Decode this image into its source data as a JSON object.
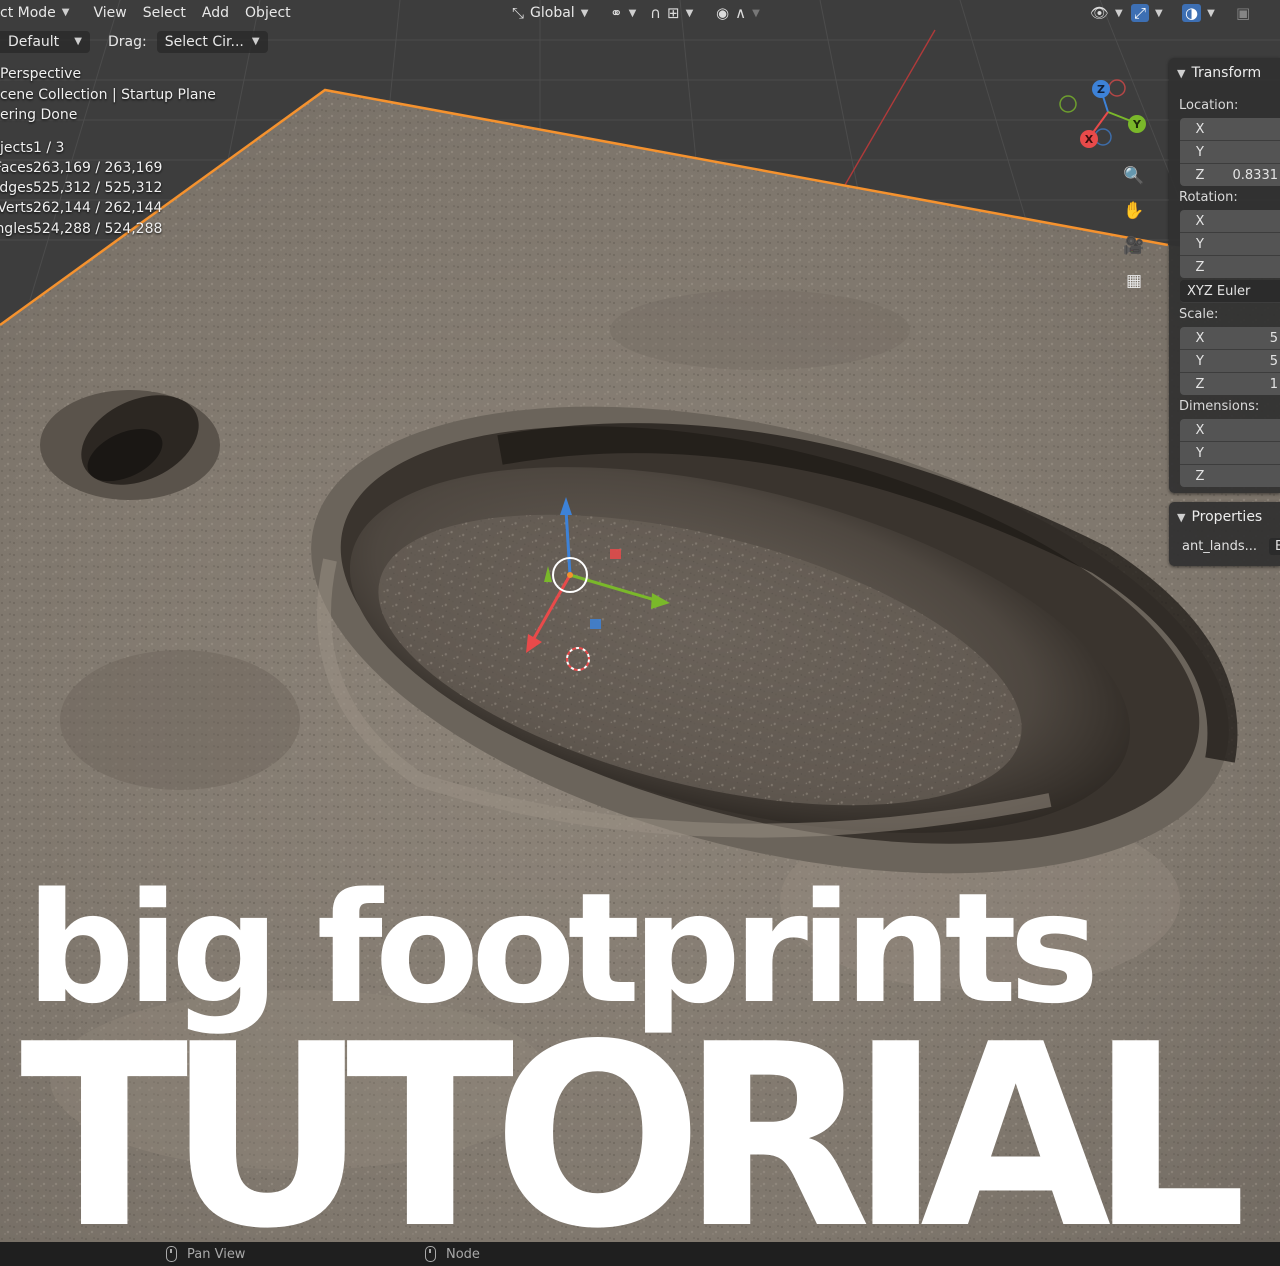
{
  "header": {
    "mode_label": "ct Mode",
    "menus": [
      "View",
      "Select",
      "Add",
      "Object"
    ],
    "transform_orientation": "Global",
    "orientation_preset": "Default",
    "drag_label": "Drag:",
    "drag_tool": "Select Cir..."
  },
  "overlay": {
    "view_name": "Perspective",
    "collection": "cene Collection | Startup Plane",
    "render_status": "ering Done",
    "stats": [
      {
        "key": "Objects",
        "value": "1 / 3"
      },
      {
        "key": "Faces",
        "value": "263,169 / 263,169"
      },
      {
        "key": "Edges",
        "value": "525,312 / 525,312"
      },
      {
        "key": "Verts",
        "value": "262,144 / 262,144"
      },
      {
        "key": "Triangles",
        "value": "524,288 / 524,288"
      }
    ]
  },
  "gizmo": {
    "x": "X",
    "y": "Y",
    "z": "Z",
    "x_color": "#e84a4a",
    "y_color": "#7ab82a",
    "z_color": "#3d82d8"
  },
  "transform_panel": {
    "title": "Transform",
    "location_label": "Location:",
    "location": [
      {
        "axis": "X",
        "value": ""
      },
      {
        "axis": "Y",
        "value": ""
      },
      {
        "axis": "Z",
        "value": "0.8331"
      }
    ],
    "rotation_label": "Rotation:",
    "rotation": [
      {
        "axis": "X",
        "value": ""
      },
      {
        "axis": "Y",
        "value": ""
      },
      {
        "axis": "Z",
        "value": ""
      }
    ],
    "rotation_mode": "XYZ Euler",
    "scale_label": "Scale:",
    "scale": [
      {
        "axis": "X",
        "value": "5"
      },
      {
        "axis": "Y",
        "value": "5"
      },
      {
        "axis": "Z",
        "value": "1"
      }
    ],
    "dimensions_label": "Dimensions:",
    "dimensions": [
      {
        "axis": "X",
        "value": ""
      },
      {
        "axis": "Y",
        "value": ""
      },
      {
        "axis": "Z",
        "value": ""
      }
    ]
  },
  "properties_panel": {
    "title": "Properties",
    "prop_name": "ant_lands...",
    "prop_value": "E"
  },
  "title": {
    "line1": "big footprints",
    "line2": "TUTORIAL"
  },
  "statusbar": {
    "pan_label": "Pan View",
    "node_label": "Node"
  },
  "colors": {
    "selection_outline": "#f5922e",
    "grid_line": "#4a4a4a",
    "terrain": "#8a8076"
  }
}
